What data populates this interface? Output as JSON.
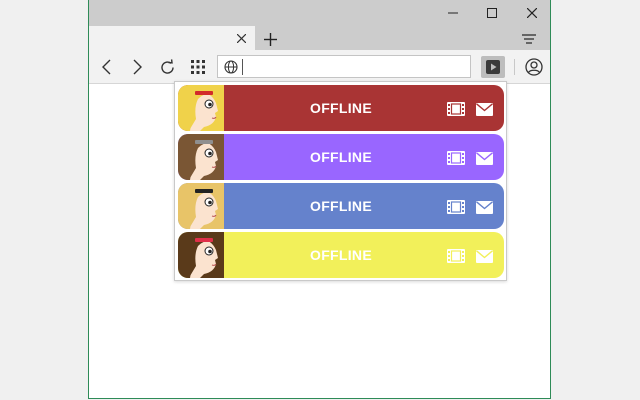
{
  "window": {
    "controls": [
      "minimize-icon",
      "maximize-icon",
      "close-icon"
    ]
  },
  "tab": {
    "title": ""
  },
  "toolbar": {
    "icons": [
      "back-icon",
      "forward-icon",
      "reload-icon",
      "apps-icon",
      "globe-icon",
      "extension-icon",
      "profile-icon"
    ],
    "address_value": ""
  },
  "popup": {
    "streamers": [
      {
        "status": "OFFLINE",
        "color": "#a93434",
        "hair": "#f0d24a",
        "accent": "#d22a2a"
      },
      {
        "status": "OFFLINE",
        "color": "#9966ff",
        "hair": "#7a5634",
        "accent": "#8f8f8f"
      },
      {
        "status": "OFFLINE",
        "color": "#6582cc",
        "hair": "#e8c468",
        "accent": "#222222"
      },
      {
        "status": "OFFLINE",
        "color": "#f2f05a",
        "hair": "#5a3a1a",
        "accent": "#e0304a"
      }
    ],
    "icons": [
      "film-icon",
      "mail-icon"
    ]
  }
}
